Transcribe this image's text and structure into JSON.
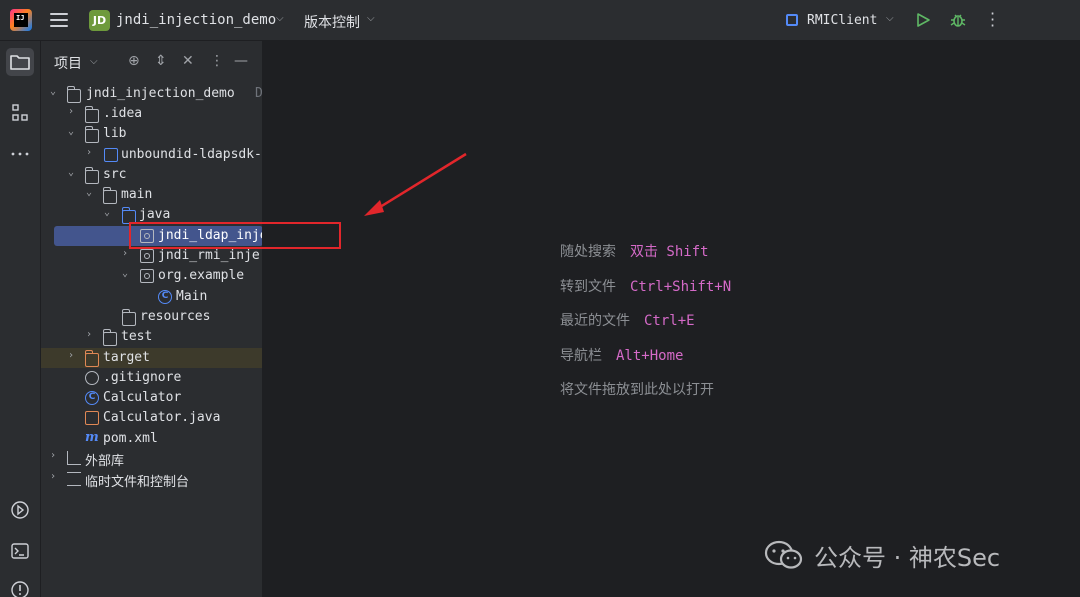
{
  "titlebar": {
    "project_badge": "JD",
    "project_name": "jndi_injection_demo",
    "vcs_label": "版本控制",
    "run_config": "RMIClient"
  },
  "project_panel": {
    "title": "项目",
    "tree": [
      {
        "label": "jndi_injection_demo",
        "suffix": "D",
        "icon": "module-folder-icon"
      },
      {
        "label": ".idea",
        "icon": "folder-icon"
      },
      {
        "label": "lib",
        "icon": "folder-icon"
      },
      {
        "label": "unboundid-ldapsdk-",
        "icon": "jar-icon"
      },
      {
        "label": "src",
        "icon": "folder-icon"
      },
      {
        "label": "main",
        "icon": "folder-icon"
      },
      {
        "label": "java",
        "icon": "source-folder-icon"
      },
      {
        "label": "jndi_ldap_injection",
        "icon": "package-icon"
      },
      {
        "label": "jndi_rmi_inje",
        "icon": "package-icon"
      },
      {
        "label": "org.example",
        "icon": "package-icon"
      },
      {
        "label": "Main",
        "icon": "class-icon"
      },
      {
        "label": "resources",
        "icon": "resources-folder-icon"
      },
      {
        "label": "test",
        "icon": "folder-icon"
      },
      {
        "label": "target",
        "icon": "excluded-folder-icon"
      },
      {
        "label": ".gitignore",
        "icon": "ignore-file-icon"
      },
      {
        "label": "Calculator",
        "icon": "class-icon"
      },
      {
        "label": "Calculator.java",
        "icon": "java-file-icon"
      },
      {
        "label": "pom.xml",
        "icon": "maven-icon"
      },
      {
        "label": "外部库",
        "icon": "library-icon"
      },
      {
        "label": "临时文件和控制台",
        "icon": "scratch-icon"
      }
    ]
  },
  "editor_hints": [
    {
      "label": "随处搜索",
      "key": "双击 Shift"
    },
    {
      "label": "转到文件",
      "key": "Ctrl+Shift+N"
    },
    {
      "label": "最近的文件",
      "key": "Ctrl+E"
    },
    {
      "label": "导航栏",
      "key": "Alt+Home"
    },
    {
      "label": "将文件拖放到此处以打开",
      "key": ""
    }
  ],
  "watermark": {
    "text": "公众号 · 神农Sec"
  },
  "colors": {
    "accent": "#548af7",
    "selection": "#43558d",
    "annotation_red": "#e2262b",
    "shortcut_pink": "#d56ac8"
  }
}
